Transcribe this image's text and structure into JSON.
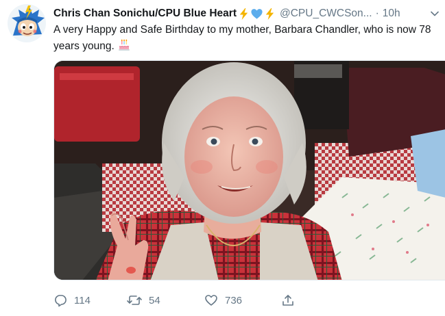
{
  "tweet": {
    "display_name": "Chris Chan Sonichu/CPU Blue Heart",
    "name_emoji": [
      "lightning-emoji",
      "blue-heart-emoji",
      "lightning-emoji"
    ],
    "handle": "@CPU_CWCSon...",
    "separator": "·",
    "timestamp": "10h",
    "text": "A very Happy and Safe Birthday to my mother, Barbara Chandler, who is now 78 years young.",
    "text_emoji": "birthday-cake-emoji",
    "media": {
      "kind": "photo",
      "subject": "elderly-woman-waving-photo"
    },
    "actions": {
      "reply_count": "114",
      "retweet_count": "54",
      "like_count": "736"
    }
  },
  "icons": {
    "reply": "reply-icon",
    "retweet": "retweet-icon",
    "like": "heart-icon",
    "share": "share-icon",
    "caret": "chevron-down-icon"
  },
  "colors": {
    "text_primary": "#14171a",
    "text_secondary": "#657786",
    "lightning": "#f4b400",
    "blue_heart": "#5dadec"
  }
}
